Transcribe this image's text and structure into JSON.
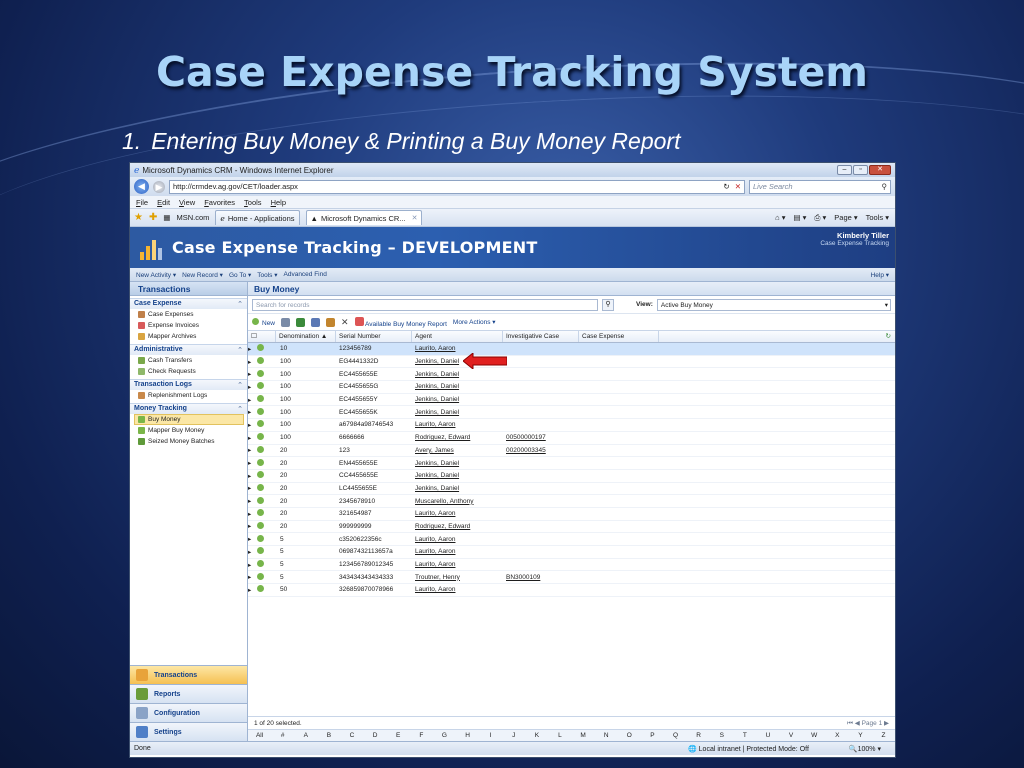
{
  "slide": {
    "title": "Case Expense Tracking System",
    "subtitle_num": "1.",
    "subtitle": "Entering Buy Money & Printing a Buy Money Report"
  },
  "browser": {
    "window_title": "Microsoft Dynamics CRM - Windows Internet Explorer",
    "url": "http://crmdev.ag.gov/CET/loader.aspx",
    "search_placeholder": "Live Search",
    "menu": [
      "File",
      "Edit",
      "View",
      "Favorites",
      "Tools",
      "Help"
    ],
    "fav_link": "MSN.com",
    "tabs": [
      "Home - Applications",
      "Microsoft Dynamics CR..."
    ],
    "tools_right": [
      "Page ▾",
      "Tools ▾"
    ],
    "status_left": "Done",
    "status_zone": "Local intranet | Protected Mode: Off",
    "zoom": "100%"
  },
  "crm": {
    "app_title": "Case Expense Tracking – DEVELOPMENT",
    "user_name": "Kimberly Tiller",
    "org_name": "Case Expense Tracking",
    "cmd": [
      "New Activity ▾",
      "New Record ▾",
      "Go To ▾",
      "Tools ▾",
      "Advanced Find"
    ],
    "help": "Help ▾",
    "nav_title": "Transactions",
    "groups": [
      {
        "title": "Case Expense",
        "items": [
          "Case Expenses",
          "Expense Invoices",
          "Mapper Archives"
        ]
      },
      {
        "title": "Administrative",
        "items": [
          "Cash Transfers",
          "Check Requests"
        ]
      },
      {
        "title": "Transaction Logs",
        "items": [
          "Replenishment Logs"
        ]
      },
      {
        "title": "Money Tracking",
        "items": [
          "Buy Money",
          "Mapper Buy Money",
          "Seized Money Batches"
        ]
      }
    ],
    "wunderbar": [
      "Transactions",
      "Reports",
      "Configuration",
      "Settings"
    ],
    "main_title": "Buy Money",
    "search_placeholder": "Search for records",
    "view_label": "View:",
    "view_value": "Active Buy Money",
    "toolbar": {
      "new": "New",
      "report": "Available Buy Money Report",
      "more": "More Actions ▾"
    },
    "columns": [
      "Denomination",
      "Serial Number",
      "Agent",
      "Investigative Case",
      "Case Expense"
    ],
    "rows": [
      {
        "d": "10",
        "s": "123456789",
        "a": "Laurito, Aaron",
        "i": ""
      },
      {
        "d": "100",
        "s": "EG4441332D",
        "a": "Jenkins, Daniel",
        "i": ""
      },
      {
        "d": "100",
        "s": "EC4455655E",
        "a": "Jenkins, Daniel",
        "i": ""
      },
      {
        "d": "100",
        "s": "EC4455655G",
        "a": "Jenkins, Daniel",
        "i": ""
      },
      {
        "d": "100",
        "s": "EC4455655Y",
        "a": "Jenkins, Daniel",
        "i": ""
      },
      {
        "d": "100",
        "s": "EC4455655K",
        "a": "Jenkins, Daniel",
        "i": ""
      },
      {
        "d": "100",
        "s": "a67984a98746543",
        "a": "Laurito, Aaron",
        "i": ""
      },
      {
        "d": "100",
        "s": "6666666",
        "a": "Rodriguez, Edward",
        "i": "00500000197"
      },
      {
        "d": "20",
        "s": "123",
        "a": "Avery, James",
        "i": "00200003345"
      },
      {
        "d": "20",
        "s": "EN4455655E",
        "a": "Jenkins, Daniel",
        "i": ""
      },
      {
        "d": "20",
        "s": "CC4455655E",
        "a": "Jenkins, Daniel",
        "i": ""
      },
      {
        "d": "20",
        "s": "LC4455655E",
        "a": "Jenkins, Daniel",
        "i": ""
      },
      {
        "d": "20",
        "s": "2345678910",
        "a": "Muscarello, Anthony",
        "i": ""
      },
      {
        "d": "20",
        "s": "321654987",
        "a": "Laurito, Aaron",
        "i": ""
      },
      {
        "d": "20",
        "s": "999999999",
        "a": "Rodriguez, Edward",
        "i": ""
      },
      {
        "d": "5",
        "s": "c3520622356c",
        "a": "Laurito, Aaron",
        "i": ""
      },
      {
        "d": "5",
        "s": "06987432113657a",
        "a": "Laurito, Aaron",
        "i": ""
      },
      {
        "d": "5",
        "s": "123456789012345",
        "a": "Laurito, Aaron",
        "i": ""
      },
      {
        "d": "5",
        "s": "343434343434333",
        "a": "Troutner, Henry",
        "i": "BN3000109"
      },
      {
        "d": "50",
        "s": "326859870078966",
        "a": "Laurito, Aaron",
        "i": ""
      }
    ],
    "selected_count": "1 of 20 selected.",
    "page": "Page 1",
    "alpha": [
      "All",
      "#",
      "A",
      "B",
      "C",
      "D",
      "E",
      "F",
      "G",
      "H",
      "I",
      "J",
      "K",
      "L",
      "M",
      "N",
      "O",
      "P",
      "Q",
      "R",
      "S",
      "T",
      "U",
      "V",
      "W",
      "X",
      "Y",
      "Z"
    ]
  },
  "colors": {
    "accent": "#15428b",
    "header": "#2c5fb0",
    "arrow": "#e02020",
    "selected_row": "#cfe3fb"
  }
}
